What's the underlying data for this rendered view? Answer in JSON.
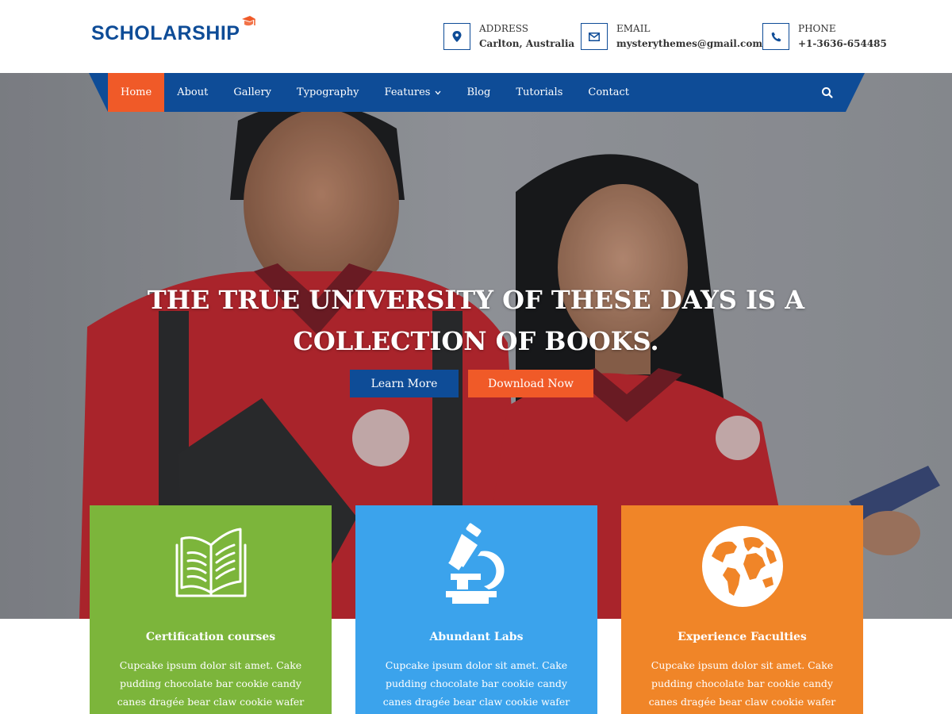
{
  "brand": {
    "logo_text": "SCHOLARSHIP",
    "primary_color": "#0e4c97",
    "accent_color": "#f05a28"
  },
  "contact": {
    "address": {
      "label": "ADDRESS",
      "value": "Carlton, Australia",
      "icon": "map-marker-icon"
    },
    "email": {
      "label": "EMAIL",
      "value": "mysterythemes@gmail.com",
      "icon": "envelope-icon"
    },
    "phone": {
      "label": "PHONE",
      "value": "+1-3636-654485",
      "icon": "phone-icon"
    }
  },
  "nav": {
    "items": [
      {
        "label": "Home",
        "active": true
      },
      {
        "label": "About"
      },
      {
        "label": "Gallery"
      },
      {
        "label": "Typography"
      },
      {
        "label": "Features",
        "has_dropdown": true
      },
      {
        "label": "Blog"
      },
      {
        "label": "Tutorials"
      },
      {
        "label": "Contact"
      }
    ],
    "search_icon": "search-icon"
  },
  "hero": {
    "headline_line1": "THE TRUE UNIVERSITY OF THESE DAYS IS A",
    "headline_line2": "COLLECTION OF BOOKS.",
    "primary_button": "Learn More",
    "secondary_button": "Download Now"
  },
  "features": [
    {
      "title": "Certification courses",
      "description": "Cupcake ipsum dolor sit amet. Cake pudding chocolate bar cookie candy canes dragée bear claw cookie wafer",
      "icon": "open-book-icon",
      "color": "#7cb53b"
    },
    {
      "title": "Abundant Labs",
      "description": "Cupcake ipsum dolor sit amet. Cake pudding chocolate bar cookie candy canes dragée bear claw cookie wafer",
      "icon": "microscope-icon",
      "color": "#3ba3ec"
    },
    {
      "title": "Experience Faculties",
      "description": "Cupcake ipsum dolor sit amet. Cake pudding chocolate bar cookie candy canes dragée bear claw cookie wafer",
      "icon": "globe-icon",
      "color": "#f08528"
    }
  ]
}
